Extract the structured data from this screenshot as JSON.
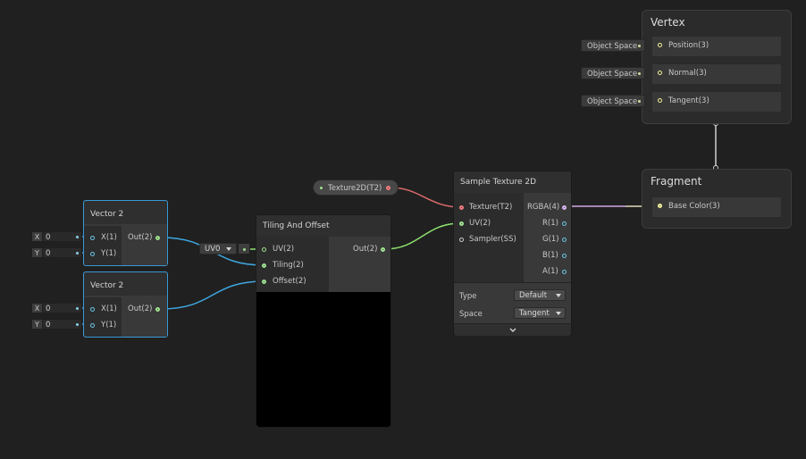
{
  "colors": {
    "canvas": "#202020",
    "node_selected_border": "#3a98d6",
    "vector_port": "#6bc7e8",
    "vector2_port": "#9fe28f",
    "texture_port": "#f27d7d",
    "color_port": "#d9b6f2",
    "vec3_port": "#f2f29c",
    "wire_vec2_blue": "#3fa7e0",
    "wire_vec2_green": "#8de06e",
    "wire_texture": "#d96b6b",
    "wire_color": "#d4a9e6",
    "wire_vec3": "#e8e89c"
  },
  "vertex": {
    "title": "Vertex",
    "blocks": [
      {
        "label": "Position(3)",
        "space": "Object Space"
      },
      {
        "label": "Normal(3)",
        "space": "Object Space"
      },
      {
        "label": "Tangent(3)",
        "space": "Object Space"
      }
    ]
  },
  "fragment": {
    "title": "Fragment",
    "blocks": [
      {
        "label": "Base Color(3)"
      }
    ]
  },
  "texture_property": {
    "label": "Texture2D(T2)"
  },
  "sample_texture": {
    "title": "Sample Texture 2D",
    "inputs": [
      "Texture(T2)",
      "UV(2)",
      "Sampler(SS)"
    ],
    "outputs": [
      "RGBA(4)",
      "R(1)",
      "G(1)",
      "B(1)",
      "A(1)"
    ],
    "type_label": "Type",
    "type_value": "Default",
    "space_label": "Space",
    "space_value": "Tangent",
    "collapse_icon": "chevron-down-icon"
  },
  "tiling": {
    "title": "Tiling And Offset",
    "inputs": [
      "UV(2)",
      "Tiling(2)",
      "Offset(2)"
    ],
    "output": "Out(2)",
    "uv_channel": "UV0"
  },
  "vector_a": {
    "title": "Vector 2",
    "inputs": [
      "X(1)",
      "Y(1)"
    ],
    "output": "Out(2)",
    "x_axis": "X",
    "x_value": "0",
    "y_axis": "Y",
    "y_value": "0"
  },
  "vector_b": {
    "title": "Vector 2",
    "inputs": [
      "X(1)",
      "Y(1)"
    ],
    "output": "Out(2)",
    "x_axis": "X",
    "x_value": "0",
    "y_axis": "Y",
    "y_value": "0"
  }
}
